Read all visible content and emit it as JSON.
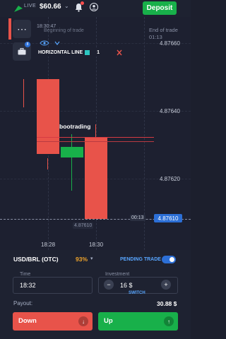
{
  "topbar": {
    "live_label": "LIVE",
    "balance": "$60.66",
    "deposit_label": "Deposit"
  },
  "chart": {
    "trade_hint_time": "18:30:47",
    "trade_hint_text": "Beginning of trade",
    "end_trade_label": "End of trade",
    "end_trade_time": "01:13",
    "drawing_tool_label": "HORIZONTAL LINE",
    "drawing_tool_count": "1",
    "watermark": "bootrading",
    "price_ticks": [
      "4.87660",
      "4.87640",
      "4.87620"
    ],
    "current_price": "4.87610",
    "timer": "00:13",
    "bottom_price": "4.87610",
    "time_labels": [
      "18:28",
      "18:30"
    ],
    "side_badge": "8",
    "colors": {
      "up": "#18b04a",
      "down": "#e8534a",
      "accent": "#2c6fd6"
    }
  },
  "panel": {
    "asset_name": "USD/BRL (OTC)",
    "asset_payout_pct": "93%",
    "pending_trade_label": "PENDING TRADE",
    "time_label": "Time",
    "time_value": "18:32",
    "investment_label": "Investment",
    "investment_value": "16 $",
    "switch_label": "SWITCH",
    "payout_label": "Payout:",
    "payout_value": "30.88 $",
    "down_label": "Down",
    "up_label": "Up"
  }
}
